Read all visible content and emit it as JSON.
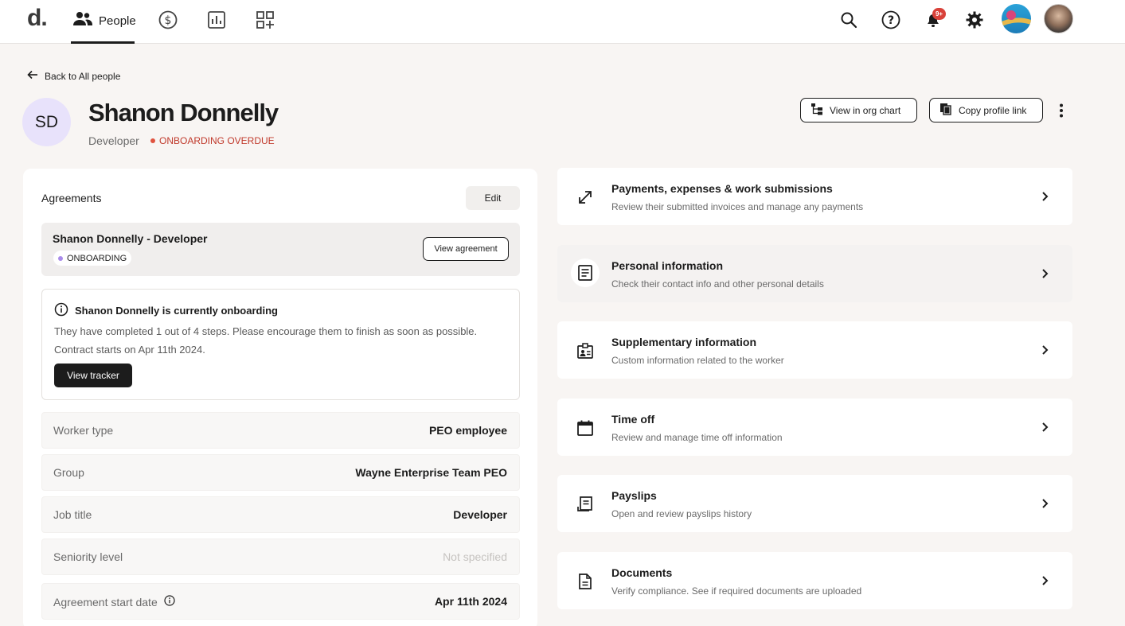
{
  "topbar": {
    "logo": "d",
    "logo_dot": ".",
    "nav_people_label": "People",
    "notification_badge": "9+"
  },
  "back_link": "Back to All people",
  "profile": {
    "initials": "SD",
    "name": "Shanon Donnelly",
    "role": "Developer",
    "status": "ONBOARDING OVERDUE",
    "status_color": "#e0533f",
    "actions": {
      "org_chart": "View in org chart",
      "copy_link": "Copy profile link"
    }
  },
  "agreements": {
    "title": "Agreements",
    "edit_label": "Edit",
    "item": {
      "name": "Shanon Donnelly - Developer",
      "status": "ONBOARDING",
      "status_color": "#a98bea",
      "view_label": "View agreement"
    },
    "onboarding": {
      "title": "Shanon Donnelly is currently onboarding",
      "text": "They have completed 1 out of 4 steps. Please encourage them to finish as soon as possible. Contract starts on Apr 11th 2024.",
      "button": "View tracker"
    },
    "fields": [
      {
        "label": "Worker type",
        "value": "PEO employee"
      },
      {
        "label": "Group",
        "value": "Wayne Enterprise Team PEO"
      },
      {
        "label": "Job title",
        "value": "Developer"
      },
      {
        "label": "Seniority level",
        "value": "Not specified"
      },
      {
        "label": "Agreement start date",
        "value": "Apr 11th 2024"
      }
    ]
  },
  "sections": [
    {
      "icon": "arrows-expand-icon",
      "title": "Payments, expenses & work submissions",
      "subtitle": "Review their submitted invoices and manage any payments"
    },
    {
      "icon": "document-lines-icon",
      "title": "Personal information",
      "subtitle": "Check their contact info and other personal details"
    },
    {
      "icon": "id-badge-icon",
      "title": "Supplementary information",
      "subtitle": "Custom information related to the worker"
    },
    {
      "icon": "calendar-icon",
      "title": "Time off",
      "subtitle": "Review and manage time off information"
    },
    {
      "icon": "receipt-icon",
      "title": "Payslips",
      "subtitle": "Open and review payslips history"
    },
    {
      "icon": "file-icon",
      "title": "Documents",
      "subtitle": "Verify compliance. See if required documents are uploaded"
    }
  ]
}
